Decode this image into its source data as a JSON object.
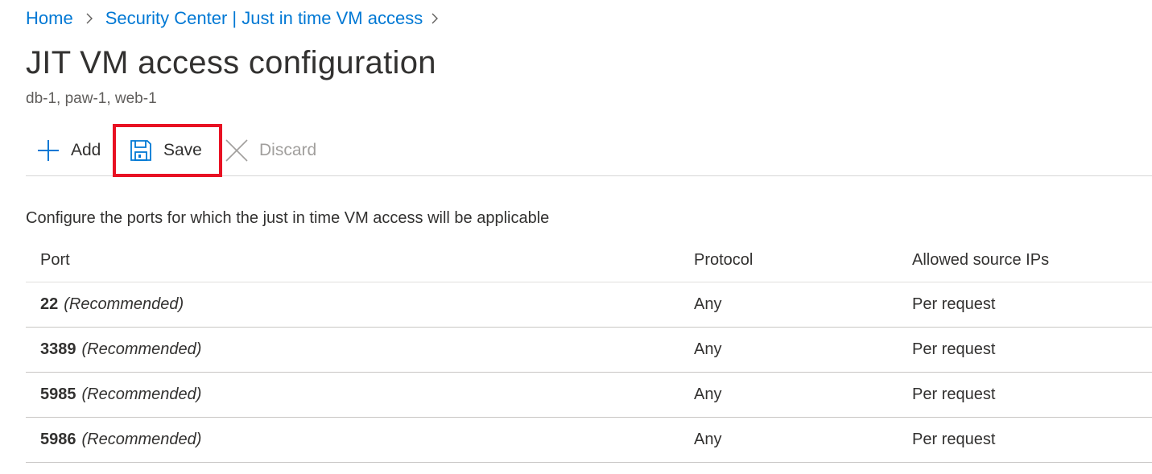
{
  "breadcrumb": {
    "items": [
      {
        "label": "Home"
      },
      {
        "label": "Security Center | Just in time VM access"
      }
    ]
  },
  "page": {
    "title": "JIT VM access configuration",
    "subtitle": "db-1, paw-1, web-1"
  },
  "toolbar": {
    "add_label": "Add",
    "save_label": "Save",
    "discard_label": "Discard",
    "add_icon": "plus-icon",
    "save_icon": "floppy-disk-icon",
    "discard_icon": "close-icon",
    "accent_color": "#0078d4",
    "highlight_color": "#e81123"
  },
  "section": {
    "description": "Configure the ports for which the just in time VM access will be applicable"
  },
  "table": {
    "columns": [
      "Port",
      "Protocol",
      "Allowed source IPs"
    ],
    "rows": [
      {
        "port": "22",
        "note": "(Recommended)",
        "protocol": "Any",
        "source_ips": "Per request"
      },
      {
        "port": "3389",
        "note": "(Recommended)",
        "protocol": "Any",
        "source_ips": "Per request"
      },
      {
        "port": "5985",
        "note": "(Recommended)",
        "protocol": "Any",
        "source_ips": "Per request"
      },
      {
        "port": "5986",
        "note": "(Recommended)",
        "protocol": "Any",
        "source_ips": "Per request"
      }
    ]
  }
}
